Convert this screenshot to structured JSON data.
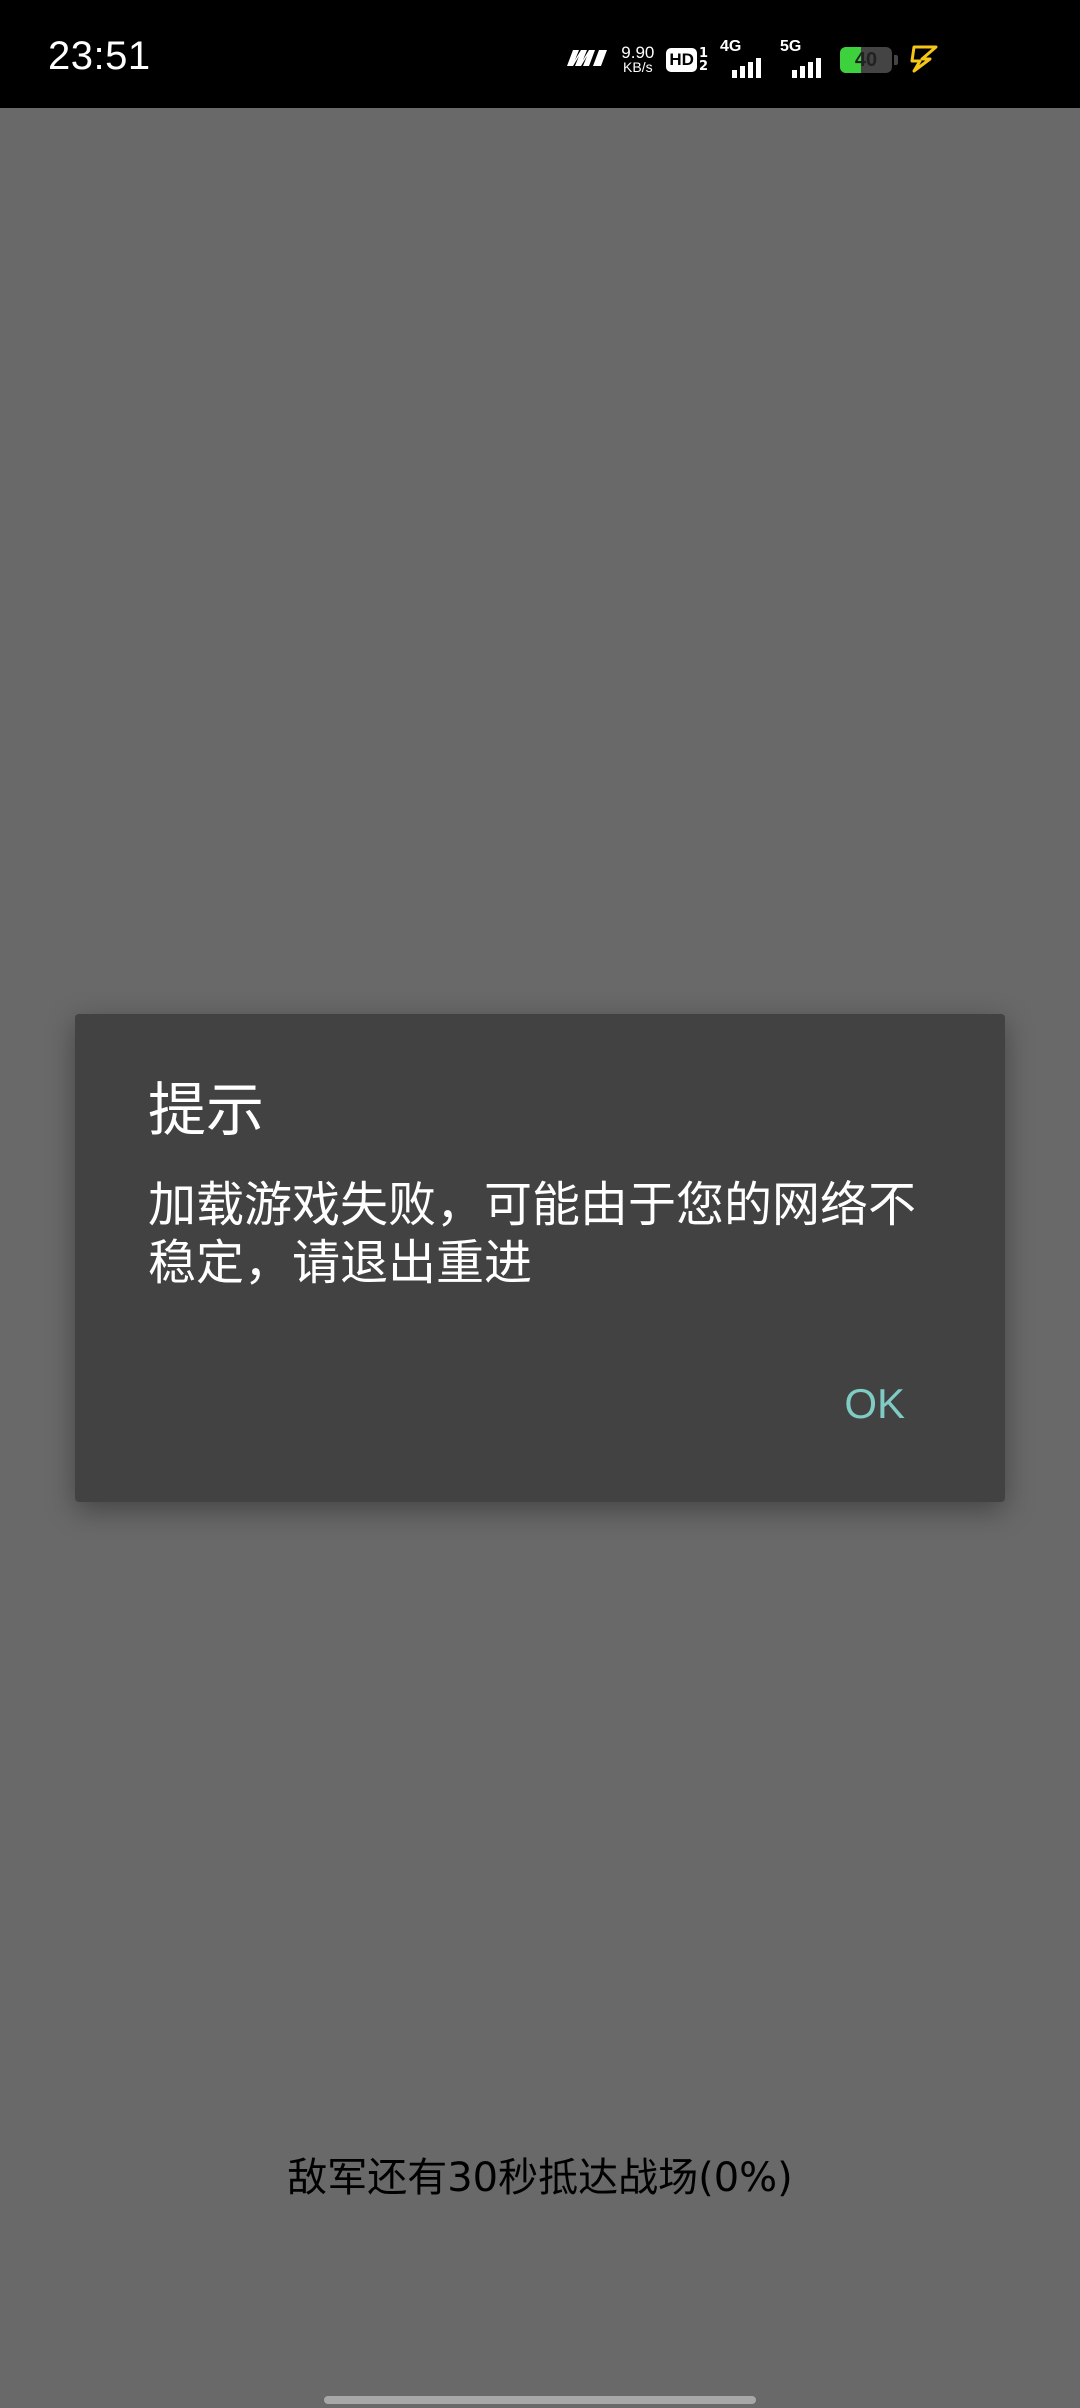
{
  "status_bar": {
    "time": "23:51",
    "net_speed_value": "9.90",
    "net_speed_unit": "KB/s",
    "hd_label": "HD",
    "hd_sim1": "1",
    "hd_sim2": "2",
    "signal1_tech": "4G",
    "signal2_tech": "5G",
    "battery_level": "40",
    "battery_fraction": 0.4,
    "colors": {
      "battery": "#3dd13d",
      "charging": "#f5c518"
    },
    "icons": [
      "carrier-logo-icon",
      "hd-voice-icon",
      "signal-4g-icon",
      "signal-5g-icon",
      "battery-icon",
      "charging-icon"
    ]
  },
  "dialog": {
    "title": "提示",
    "message": "加载游戏失败，可能由于您的网络不稳定，请退出重进",
    "ok_label": "OK",
    "colors": {
      "background": "#424242",
      "ok_text": "#80cbc4"
    }
  },
  "game": {
    "countdown_text": "敌军还有30秒抵达战场(0%)",
    "progress_percent": 0
  }
}
